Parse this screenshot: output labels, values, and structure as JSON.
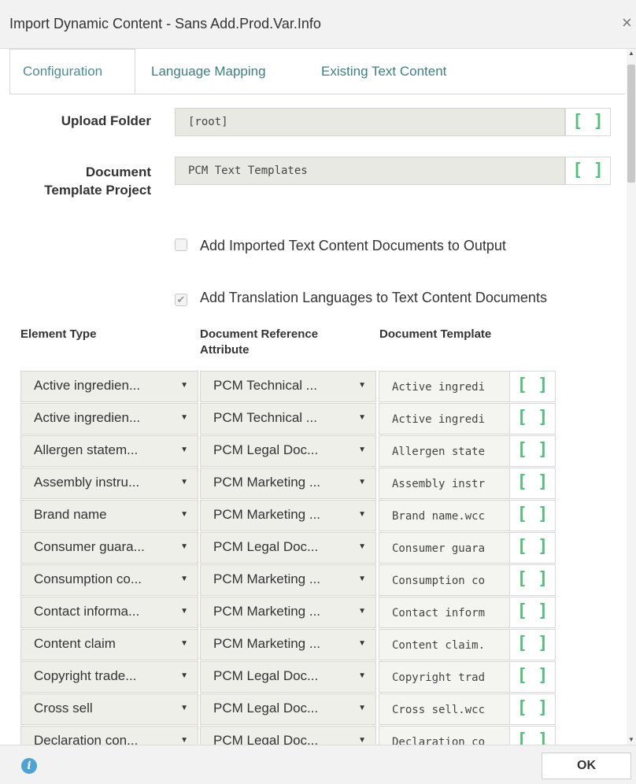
{
  "window": {
    "title": "Import Dynamic Content - Sans Add.Prod.Var.Info",
    "close_glyph": "×"
  },
  "tabs": [
    {
      "label": "Configuration",
      "active": true
    },
    {
      "label": "Language Mapping",
      "active": false
    },
    {
      "label": "Existing Text Content",
      "active": false
    }
  ],
  "form": {
    "upload_folder": {
      "label": "Upload Folder",
      "value": "[root]"
    },
    "document_template_project": {
      "label_line1": "Document",
      "label_line2": "Template Project",
      "value": "PCM Text Templates"
    },
    "bracket_glyph": "[ ]",
    "add_imported": {
      "label": "Add Imported Text Content Documents to Output",
      "checked": false
    },
    "add_translation": {
      "label": "Add Translation Languages to Text Content Documents",
      "checked": true
    }
  },
  "table": {
    "headers": {
      "element_type": "Element Type",
      "doc_ref_line1": "Document Reference",
      "doc_ref_line2": "Attribute",
      "doc_template": "Document Template"
    },
    "caret": "▼",
    "rows": [
      {
        "element_type": "Active ingredien...",
        "doc_ref": "PCM Technical ...",
        "template": "Active ingredi"
      },
      {
        "element_type": "Active ingredien...",
        "doc_ref": "PCM Technical ...",
        "template": "Active ingredi"
      },
      {
        "element_type": "Allergen statem...",
        "doc_ref": "PCM Legal Doc...",
        "template": "Allergen state"
      },
      {
        "element_type": "Assembly instru...",
        "doc_ref": "PCM Marketing ...",
        "template": "Assembly instr"
      },
      {
        "element_type": "Brand name",
        "doc_ref": "PCM Marketing ...",
        "template": "Brand name.wcc"
      },
      {
        "element_type": "Consumer guara...",
        "doc_ref": "PCM Legal Doc...",
        "template": "Consumer guara"
      },
      {
        "element_type": "Consumption co...",
        "doc_ref": "PCM Marketing ...",
        "template": "Consumption co"
      },
      {
        "element_type": "Contact informa...",
        "doc_ref": "PCM Marketing ...",
        "template": "Contact inform"
      },
      {
        "element_type": "Content claim",
        "doc_ref": "PCM Marketing ...",
        "template": "Content claim."
      },
      {
        "element_type": "Copyright trade...",
        "doc_ref": "PCM Legal Doc...",
        "template": "Copyright trad"
      },
      {
        "element_type": "Cross sell",
        "doc_ref": "PCM Legal Doc...",
        "template": "Cross sell.wcc"
      },
      {
        "element_type": "Declaration con...",
        "doc_ref": "PCM Legal Doc...",
        "template": "Declaration co"
      }
    ]
  },
  "footer": {
    "ok_label": "OK",
    "info_glyph": "i"
  },
  "colors": {
    "accent_teal": "#3c7f86",
    "bracket_green": "#52c27a",
    "info_blue": "#4ba3d6"
  }
}
